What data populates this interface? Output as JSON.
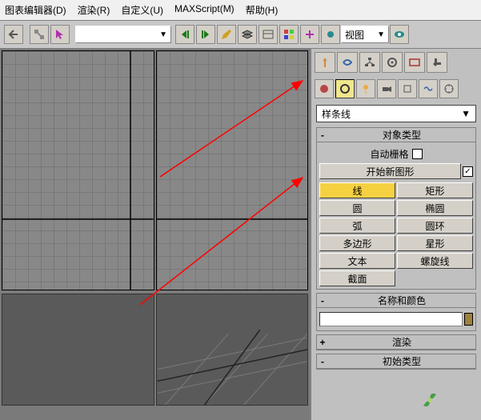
{
  "menu": {
    "editor": "图表编辑器(D)",
    "render": "渲染(R)",
    "customize": "自定义(U)",
    "maxscript": "MAXScript(M)",
    "help": "帮助(H)"
  },
  "toolbar": {
    "viewport_label": "视图"
  },
  "sidebar": {
    "category_dropdown": "样条线",
    "rollout_object_type": "对象类型",
    "auto_grid": "自动栅格",
    "start_new_shape": "开始新图形",
    "buttons": [
      "线",
      "矩形",
      "圆",
      "椭圆",
      "弧",
      "圆环",
      "多边形",
      "星形",
      "文本",
      "螺旋线",
      "截面",
      ""
    ],
    "rollout_name_color": "名称和颜色",
    "rollout_render": "渲染",
    "rollout_init": "初始类型"
  }
}
